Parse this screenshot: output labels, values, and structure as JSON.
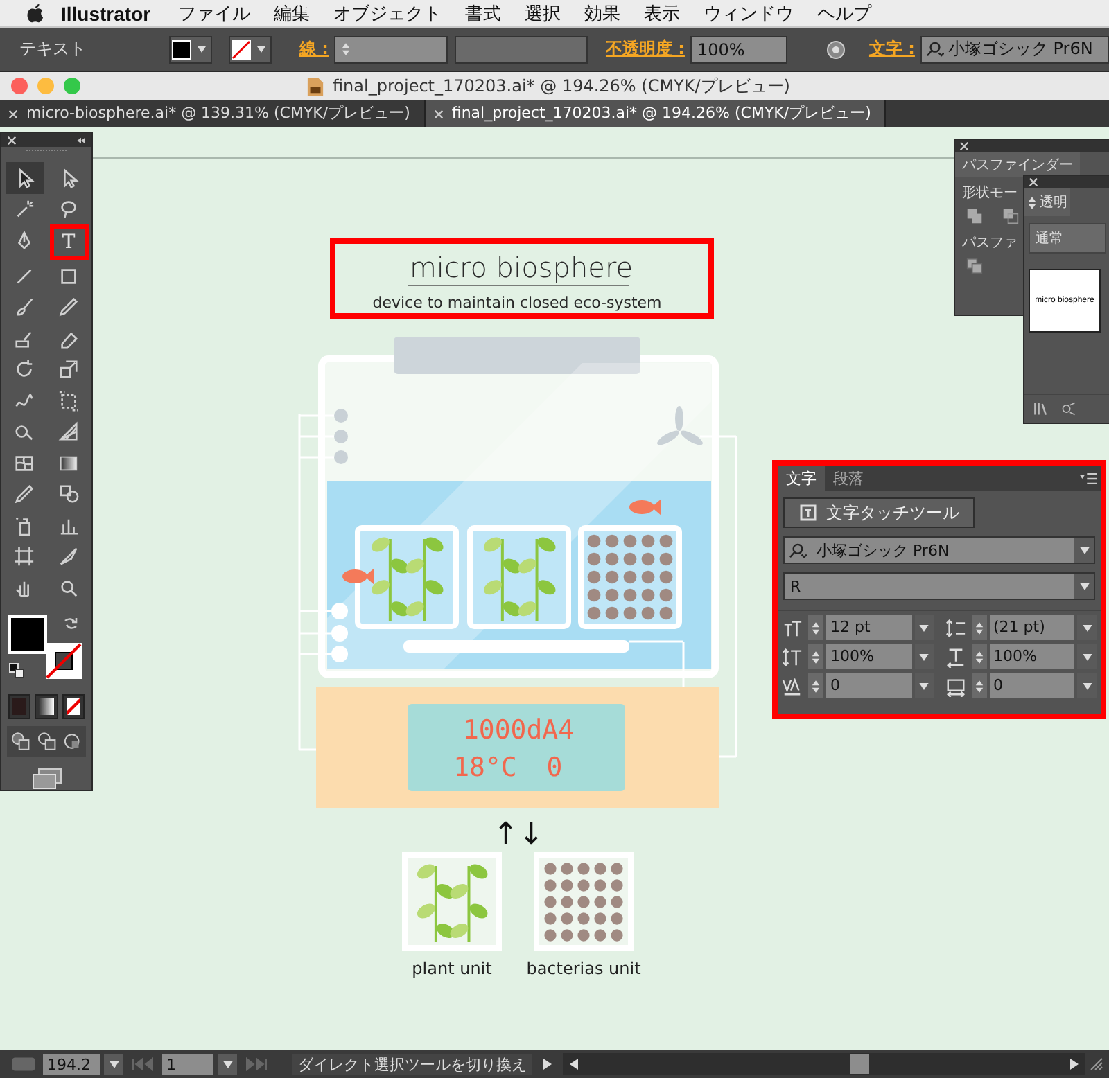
{
  "menu_bar": {
    "app": "Illustrator",
    "items": [
      "ファイル",
      "編集",
      "オブジェクト",
      "書式",
      "選択",
      "効果",
      "表示",
      "ウィンドウ",
      "ヘルプ"
    ]
  },
  "control_bar": {
    "label": "テキスト",
    "stroke_label": "線 :",
    "opacity_label": "不透明度 :",
    "opacity": "100%",
    "font_label": "文字 :",
    "font": "小塚ゴシック Pr6N"
  },
  "window": {
    "title": "final_project_170203.ai* @ 194.26% (CMYK/プレビュー)"
  },
  "tabs": [
    {
      "label": "micro-biosphere.ai* @ 139.31% (CMYK/プレビュー)",
      "selected": false
    },
    {
      "label": "final_project_170203.ai* @ 194.26% (CMYK/プレビュー)",
      "selected": true
    }
  ],
  "tools": [
    {
      "kind": "select",
      "selected": true,
      "highlighted": false
    },
    {
      "kind": "direct",
      "selected": false,
      "highlighted": false
    },
    {
      "kind": "magic",
      "selected": false,
      "highlighted": false
    },
    {
      "kind": "lasso",
      "selected": false,
      "highlighted": false
    },
    {
      "kind": "pen",
      "selected": false,
      "highlighted": false
    },
    {
      "kind": "type",
      "glyph": "T",
      "selected": false,
      "highlighted": true
    },
    {
      "kind": "line",
      "selected": false,
      "highlighted": false
    },
    {
      "kind": "rect",
      "selected": false,
      "highlighted": false
    },
    {
      "kind": "brush",
      "selected": false,
      "highlighted": false
    },
    {
      "kind": "pencil",
      "selected": false,
      "highlighted": false
    },
    {
      "kind": "blob",
      "selected": false,
      "highlighted": false
    },
    {
      "kind": "eraser",
      "selected": false,
      "highlighted": false
    },
    {
      "kind": "rotate",
      "selected": false,
      "highlighted": false
    },
    {
      "kind": "scale",
      "selected": false,
      "highlighted": false
    },
    {
      "kind": "warp",
      "selected": false,
      "highlighted": false
    },
    {
      "kind": "free",
      "selected": false,
      "highlighted": false
    },
    {
      "kind": "shape",
      "selected": false,
      "highlighted": false
    },
    {
      "kind": "perspective",
      "selected": false,
      "highlighted": false
    },
    {
      "kind": "mesh",
      "selected": false,
      "highlighted": false
    },
    {
      "kind": "gradient",
      "selected": false,
      "highlighted": false
    },
    {
      "kind": "eyedropper",
      "selected": false,
      "highlighted": false
    },
    {
      "kind": "blend",
      "selected": false,
      "highlighted": false
    },
    {
      "kind": "symbol",
      "selected": false,
      "highlighted": false
    },
    {
      "kind": "graph",
      "selected": false,
      "highlighted": false
    },
    {
      "kind": "artboard",
      "selected": false,
      "highlighted": false
    },
    {
      "kind": "slice",
      "selected": false,
      "highlighted": false
    },
    {
      "kind": "hand",
      "selected": false,
      "highlighted": false
    },
    {
      "kind": "zoom",
      "selected": false,
      "highlighted": false
    }
  ],
  "artboard": {
    "title": "micro biosphere",
    "subtitle": "device to maintain closed eco-system",
    "heading_highlighted": true,
    "trays": [
      {
        "kind": "plant"
      },
      {
        "kind": "plant"
      },
      {
        "kind": "bacteria"
      }
    ],
    "display": {
      "line_1": "1000dA4",
      "temperature": "18°C",
      "value": "0"
    },
    "exchange_arrows": "↑↓",
    "units": [
      {
        "kind": "plant",
        "label": "plant unit"
      },
      {
        "kind": "bacteria",
        "label": "bacterias unit"
      }
    ]
  },
  "pathfinder_panel": {
    "title": "パスファインダー",
    "shape_modes_label": "形状モー",
    "pathfinders_label": "パスファ"
  },
  "transparency_panel": {
    "tab": "透明",
    "blend_mode": "通常",
    "thumbnail_text": "micro biosphere"
  },
  "character_panel": {
    "highlighted": true,
    "tabs": [
      {
        "label": "文字",
        "selected": true
      },
      {
        "label": "段落",
        "selected": false
      }
    ],
    "touch_button": "文字タッチツール",
    "font": "小塚ゴシック Pr6N",
    "style": "R",
    "fields": [
      {
        "kind": "size",
        "value": "12 pt"
      },
      {
        "kind": "leading",
        "value": "(21 pt)"
      },
      {
        "kind": "vscale",
        "value": "100%"
      },
      {
        "kind": "hscale",
        "value": "100%"
      },
      {
        "kind": "kerning",
        "value": "0"
      },
      {
        "kind": "tracking",
        "value": "0"
      }
    ]
  },
  "status_bar": {
    "zoom": "194.2",
    "page": "1",
    "message": "ダイレクト選択ツールを切り換え"
  }
}
